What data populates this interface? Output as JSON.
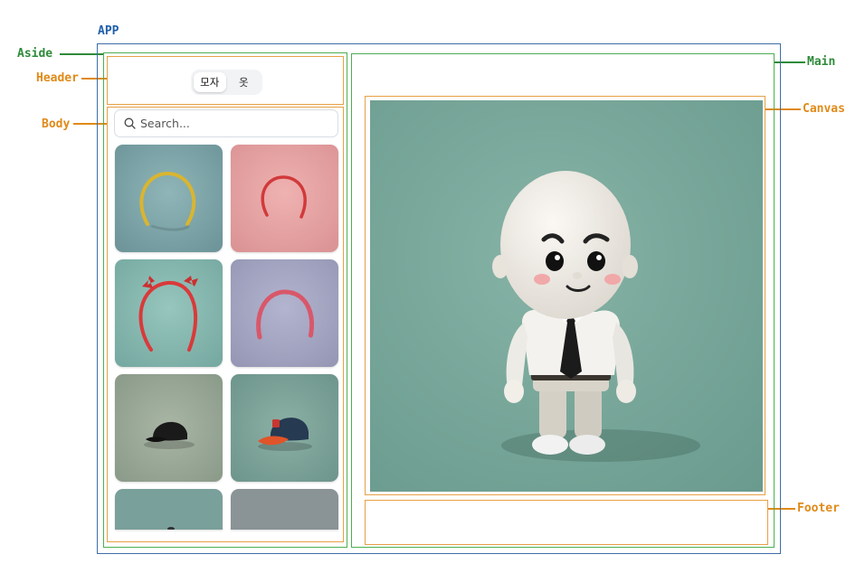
{
  "labels": {
    "app": "APP",
    "aside": "Aside",
    "header": "Header",
    "body": "Body",
    "main": "Main",
    "canvas": "Canvas",
    "footer": "Footer"
  },
  "tabs": [
    {
      "label": "모자",
      "active": true
    },
    {
      "label": "옷",
      "active": false
    }
  ],
  "search": {
    "placeholder": "Search..."
  },
  "items": [
    {
      "icon": "yellow-headband-icon",
      "bg": "#7fa5a8"
    },
    {
      "icon": "red-headband-icon",
      "bg": "#e6a4a4"
    },
    {
      "icon": "red-bow-headband-icon",
      "bg": "#86b8b0"
    },
    {
      "icon": "pink-braided-headband-icon",
      "bg": "#a6a8c4"
    },
    {
      "icon": "black-cap-icon",
      "bg": "#9aaa98"
    },
    {
      "icon": "navy-orange-cap-icon",
      "bg": "#7fa39a"
    },
    {
      "icon": "partial-item-icon",
      "bg": "#7aa09b"
    },
    {
      "icon": "partial-item-icon",
      "bg": "#8a9396"
    }
  ],
  "colors": {
    "app_border": "#3d6ea8",
    "region_border": "#4caf50",
    "component_border": "#e8a046",
    "canvas_bg": "#79a99c"
  },
  "canvas": {
    "icon": "character-with-tie-icon"
  }
}
